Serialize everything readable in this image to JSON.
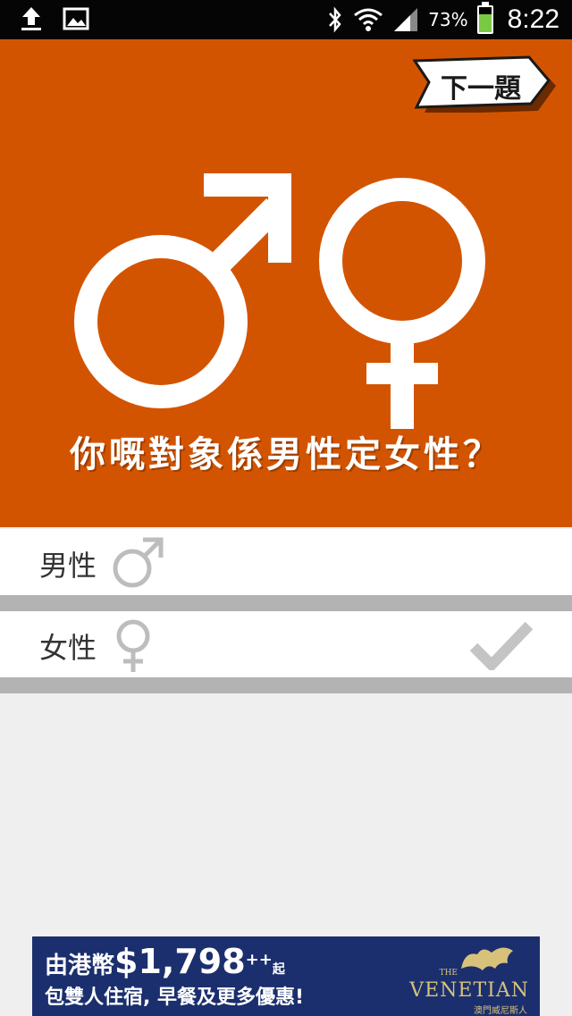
{
  "status_bar": {
    "battery_percent": "73%",
    "battery_level": 0.73,
    "time": "8:22",
    "icons": [
      "upload-icon",
      "image-icon",
      "bluetooth-icon",
      "wifi-icon",
      "signal-icon",
      "battery-icon"
    ]
  },
  "hero": {
    "background": "#d35400",
    "next_label": "下一題",
    "question": "你嘅對象係男性定女性？"
  },
  "options": [
    {
      "label": "男性",
      "icon": "male-symbol-icon",
      "selected": false
    },
    {
      "label": "女性",
      "icon": "female-symbol-icon",
      "selected": true
    }
  ],
  "ad": {
    "prefix": "由港幣",
    "price": "$1,798",
    "plus": "++",
    "suffix": "起",
    "line2": "包雙人住宿, 早餐及更多優惠!",
    "brand_the": "THE",
    "brand": "VENETIAN",
    "brand_sub": "澳門威尼斯人"
  }
}
